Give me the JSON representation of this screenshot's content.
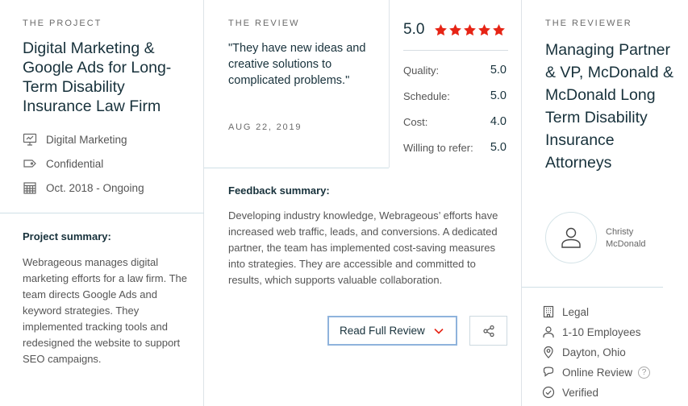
{
  "project": {
    "eyebrow": "THE PROJECT",
    "title": "Digital Marketing & Google Ads for Long-Term Disability Insurance Law Firm",
    "meta": [
      {
        "icon": "presentation-icon",
        "text": "Digital Marketing"
      },
      {
        "icon": "tag-icon",
        "text": "Confidential"
      },
      {
        "icon": "calendar-icon",
        "text": "Oct. 2018 - Ongoing"
      }
    ],
    "summary_heading": "Project summary:",
    "summary_text": "Webrageous manages digital marketing efforts for a law firm. The team directs Google Ads and keyword strategies. They implemented tracking tools and redesigned the website to support SEO campaigns."
  },
  "review": {
    "eyebrow": "THE REVIEW",
    "quote": "\"They have new ideas and creative solutions to complicated problems.\"",
    "date": "AUG 22, 2019",
    "overall": "5.0",
    "stars": 5,
    "star_color": "#e62415",
    "ratings": [
      {
        "label": "Quality:",
        "value": "5.0"
      },
      {
        "label": "Schedule:",
        "value": "5.0"
      },
      {
        "label": "Cost:",
        "value": "4.0"
      },
      {
        "label": "Willing to refer:",
        "value": "5.0"
      }
    ],
    "feedback_heading": "Feedback summary:",
    "feedback_text": "Developing industry knowledge, Webrageous’ efforts have increased web traffic, leads, and conversions. A dedicated partner, the team has implemented cost-saving measures into strategies. They are accessible and committed to results, which supports valuable collaboration.",
    "read_button": "Read Full Review",
    "accent_color": "#e62415"
  },
  "reviewer": {
    "eyebrow": "THE REVIEWER",
    "title": "Managing Partner & VP, McDonald & McDonald Long Term Disability Insurance Attorneys",
    "name": "Christy McDonald",
    "meta": [
      {
        "icon": "building-icon",
        "text": "Legal"
      },
      {
        "icon": "user-icon",
        "text": "1-10 Employees"
      },
      {
        "icon": "location-pin-icon",
        "text": "Dayton, Ohio"
      },
      {
        "icon": "chat-bubble-icon",
        "text": "Online Review",
        "help": "?"
      },
      {
        "icon": "check-circle-icon",
        "text": "Verified"
      }
    ]
  }
}
